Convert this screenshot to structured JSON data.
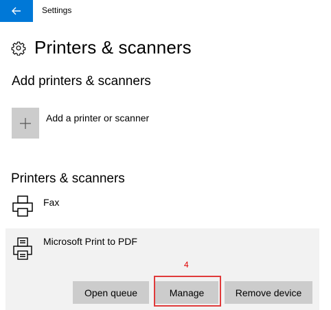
{
  "window": {
    "title": "Settings",
    "back_icon": "back-arrow-icon"
  },
  "page": {
    "title": "Printers & scanners",
    "icon": "gear-icon"
  },
  "add_section": {
    "heading": "Add printers & scanners",
    "add_button_label": "Add a printer or scanner",
    "add_icon": "plus-icon"
  },
  "list_section": {
    "heading": "Printers & scanners",
    "devices": [
      {
        "name": "Fax",
        "icon": "fax-printer-icon"
      },
      {
        "name": "Microsoft Print to PDF",
        "icon": "pdf-printer-icon",
        "selected": true
      }
    ]
  },
  "device_actions": {
    "open_queue": "Open queue",
    "manage": "Manage",
    "remove_device": "Remove device"
  },
  "annotation": {
    "label": "4",
    "color": "#e00000"
  },
  "colors": {
    "accent": "#0078d7",
    "button_bg": "#cccccc",
    "selected_bg": "#f2f2f2"
  }
}
